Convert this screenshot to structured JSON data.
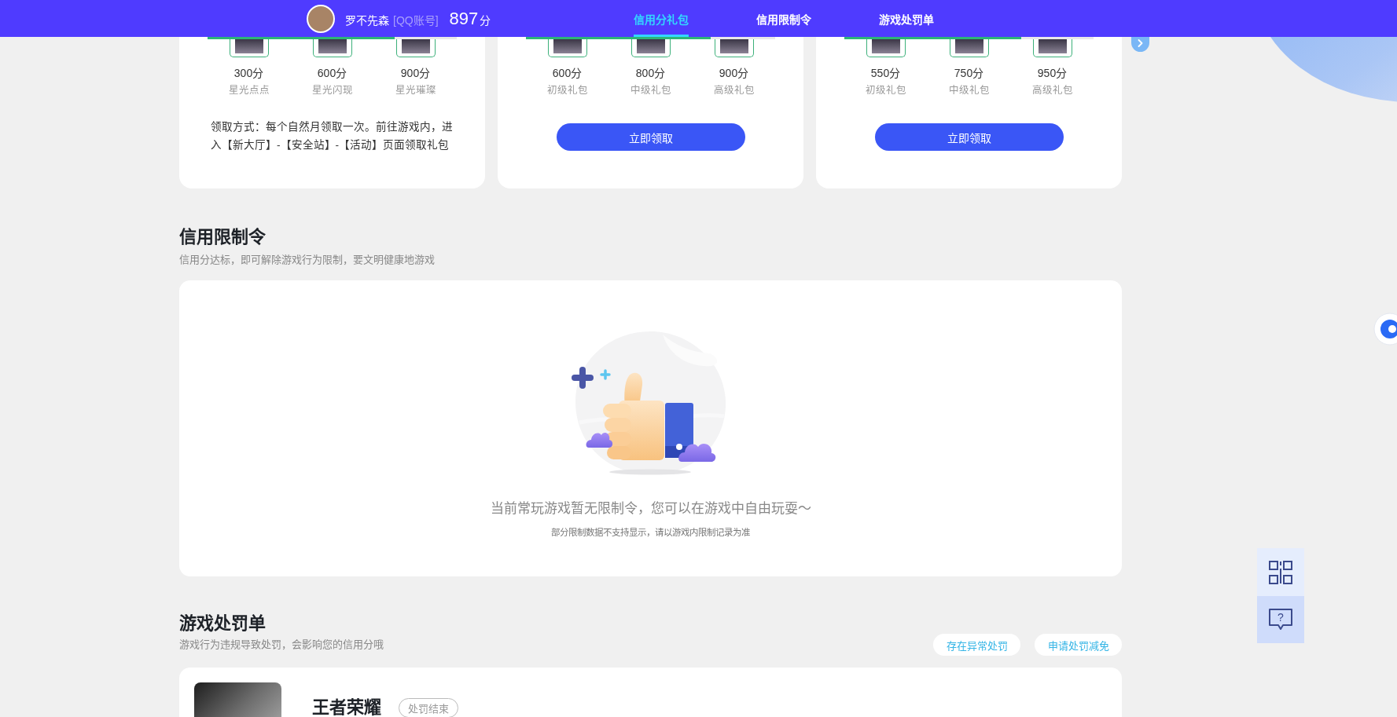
{
  "header": {
    "user": {
      "name": "罗不先森",
      "account_label": "[QQ账号]",
      "score": "897",
      "score_unit": "分"
    },
    "tabs": [
      {
        "label": "信用分礼包",
        "selected": true
      },
      {
        "label": "信用限制令",
        "selected": false
      },
      {
        "label": "游戏处罚单",
        "selected": false
      }
    ]
  },
  "gift_cards": [
    {
      "level": 0.75,
      "tiers": [
        {
          "score": "300分",
          "name": "星光点点"
        },
        {
          "score": "600分",
          "name": "星光闪现"
        },
        {
          "score": "900分",
          "name": "星光璀璨"
        }
      ],
      "note": "领取方式：每个自然月领取一次。前往游戏内，进入【新大厅】-【安全站】-【活动】页面领取礼包"
    },
    {
      "level": 0.74,
      "tiers": [
        {
          "score": "600分",
          "name": "初级礼包"
        },
        {
          "score": "800分",
          "name": "中级礼包"
        },
        {
          "score": "900分",
          "name": "高级礼包"
        }
      ],
      "button": "立即领取"
    },
    {
      "level": 0.71,
      "tiers": [
        {
          "score": "550分",
          "name": "初级礼包"
        },
        {
          "score": "750分",
          "name": "中级礼包"
        },
        {
          "score": "950分",
          "name": "高级礼包"
        }
      ],
      "button": "立即领取"
    }
  ],
  "restriction_section": {
    "title": "信用限制令",
    "subtitle": "信用分达标，即可解除游戏行为限制，要文明健康地游戏",
    "empty_message": "当前常玩游戏暂无限制令，您可以在游戏中自由玩耍～",
    "empty_note": "部分限制数据不支持显示，请以游戏内限制记录为准"
  },
  "penalty_section": {
    "title": "游戏处罚单",
    "subtitle": "游戏行为违规导致处罚，会影响您的信用分哦",
    "actions": [
      "存在异常处罚",
      "申请处罚减免"
    ],
    "records": [
      {
        "game": "王者荣耀",
        "status": "处罚结束"
      }
    ]
  },
  "side_tools": {
    "help_mark": "?"
  }
}
